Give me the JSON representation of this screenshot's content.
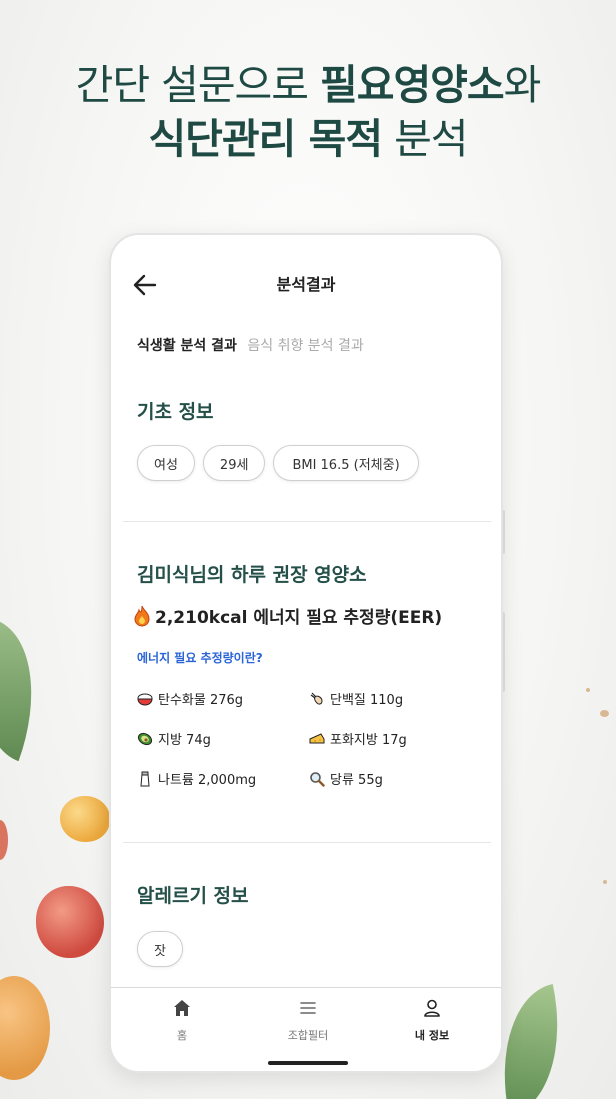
{
  "headline": {
    "line1_normal": "간단 설문으로 ",
    "line1_bold": "필요영양소",
    "line1_tail": "와",
    "line2_bold": "식단관리 목적",
    "line2_tail": " 분석"
  },
  "appbar": {
    "title": "분석결과",
    "back_icon": "arrow-left-icon"
  },
  "tabs": [
    {
      "label": "식생활 분석 결과",
      "active": true
    },
    {
      "label": "음식 취향 분석 결과",
      "active": false
    }
  ],
  "basic_info": {
    "title": "기초 정보",
    "chips": [
      "여성",
      "29세",
      "BMI 16.5 (저체중)"
    ]
  },
  "nutrition": {
    "title": "김미식님의 하루 권장 영양소",
    "eer_text": "2,210kcal 에너지 필요 추정량(EER)",
    "eer_icon": "fire-icon",
    "link_text": "에너지 필요 추정량이란?",
    "items": [
      {
        "label": "탄수화물 276g",
        "icon": "rice-bowl-icon"
      },
      {
        "label": "단백질 110g",
        "icon": "drumstick-icon"
      },
      {
        "label": "지방 74g",
        "icon": "avocado-icon"
      },
      {
        "label": "포화지방 17g",
        "icon": "cheese-icon"
      },
      {
        "label": "나트륨 2,000mg",
        "icon": "salt-shaker-icon"
      },
      {
        "label": "당류 55g",
        "icon": "magnifier-icon"
      }
    ]
  },
  "allergy": {
    "title": "알레르기 정보",
    "chips": [
      "잣"
    ]
  },
  "navbar": {
    "items": [
      {
        "label": "홈",
        "icon": "home-icon",
        "active": false
      },
      {
        "label": "조합필터",
        "icon": "menu-icon",
        "active": false
      },
      {
        "label": "내 정보",
        "icon": "user-icon",
        "active": true
      }
    ]
  },
  "colors": {
    "headline": "#1f4a44",
    "section_title": "#245049",
    "link": "#2a64d6"
  }
}
